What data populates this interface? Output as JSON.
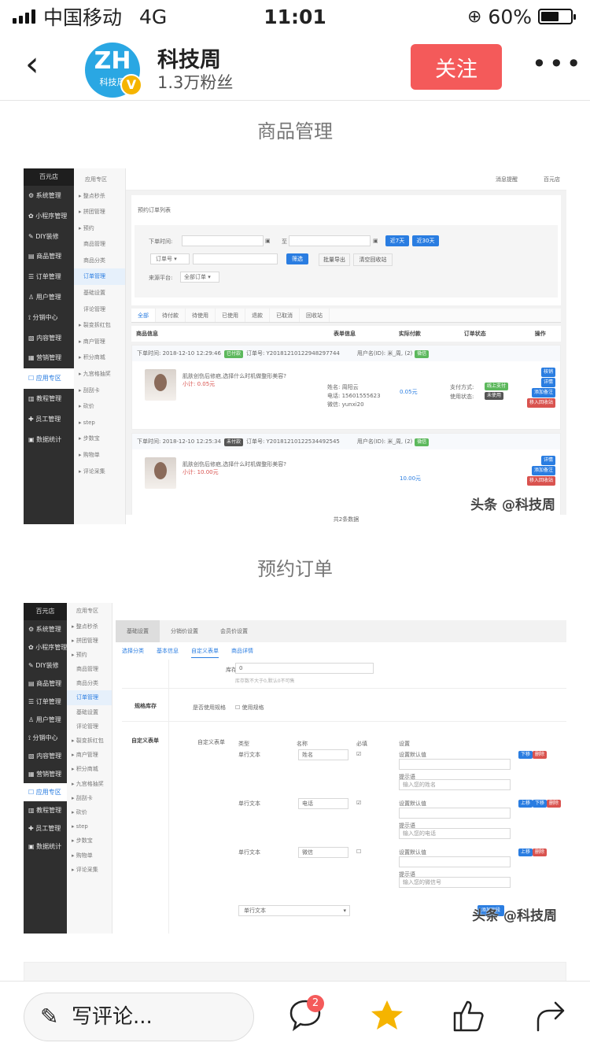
{
  "status": {
    "carrier": "中国移动",
    "network": "4G",
    "time": "11:01",
    "battery_pct": "60%",
    "battery_level": 0.6
  },
  "header": {
    "author": "科技周",
    "avatar_text": "ZH",
    "avatar_sub": "科技周",
    "verified": "V",
    "fans": "1.3万粉丝",
    "follow": "关注"
  },
  "captions": {
    "first": "商品管理",
    "second": "预约订单"
  },
  "watermark": "头条 @科技周",
  "admin": {
    "brand": "百元店",
    "sidebar": [
      "系统管理",
      "小程序管理",
      "DIY装修",
      "商品管理",
      "订单管理",
      "用户管理",
      "分销中心",
      "内容管理",
      "营销管理",
      "应用专区",
      "教程管理",
      "员工管理",
      "数据统计"
    ],
    "sidebar_active": 9,
    "sub_title": "应用专区",
    "sub_items": [
      "整点秒杀",
      "拼团管理",
      "预约",
      "商品管理",
      "商品分类",
      "订单管理",
      "基础设置",
      "评论管理",
      "裂变拆红包",
      "商户管理",
      "积分商城",
      "九宫格抽奖",
      "刮刮卡",
      "砍价",
      "step",
      "步数宝",
      "购物单",
      "评论采集"
    ]
  },
  "shot1": {
    "topbar": {
      "msg": "消息提醒",
      "store": "百元店"
    },
    "panel_title": "预约订单列表",
    "filter": {
      "time_label": "下单时间:",
      "to": "至",
      "btn_7": "近7天",
      "btn_30": "近30天",
      "order_no": "订单号",
      "search": "筛选",
      "export": "批量导出",
      "clear": "清空回收站",
      "source_label": "来源平台:",
      "source_value": "全部订单"
    },
    "tabs": [
      "全部",
      "待付款",
      "待使用",
      "已使用",
      "退款",
      "已取消",
      "回收站"
    ],
    "columns": [
      "商品信息",
      "表单信息",
      "实际付款",
      "订单状态",
      "操作"
    ],
    "orders": [
      {
        "time": "下单时间: 2018-12-10 12:29:46",
        "tag": "已付款",
        "tag_color": "#5cb85c",
        "order_no": "订单号: Y20181210122948297744",
        "user": "用户名(ID): 米_周, (2)",
        "user_tag": "微信",
        "title": "肌肤创伤后修疤,选择什么时机做整形美容?",
        "subtotal": "小计: 0.05元",
        "form": [
          "姓名: 周阳云",
          "电话: 15601555623",
          "微信: yunxi20"
        ],
        "paid": "0.05元",
        "status": [
          "支付方式:",
          "线上支付",
          "使用状态:",
          "未使用"
        ],
        "ops": [
          "核销",
          "详情",
          "添加备注",
          "移入回收站"
        ]
      },
      {
        "time": "下单时间: 2018-12-10 12:25:34",
        "tag": "未付款",
        "tag_color": "#555555",
        "order_no": "订单号: Y20181210122534492545",
        "user": "用户名(ID): 米_周, (2)",
        "user_tag": "微信",
        "title": "肌肤创伤后修疤,选择什么时机做整形美容?",
        "subtotal": "小计: 10.00元",
        "form": [],
        "paid": "10.00元",
        "status": [],
        "ops": [
          "详情",
          "添加备注",
          "移入回收站"
        ]
      }
    ],
    "footer": "共2条数据"
  },
  "shot2": {
    "top_tabs": [
      "基础设置",
      "分销价设置",
      "会员价设置"
    ],
    "sub_tabs": [
      "选择分类",
      "基本信息",
      "自定义表单",
      "商品详情"
    ],
    "stock_label": "库存",
    "stock_value": "0",
    "stock_hint": "库存数不大于0,默认0不可售",
    "spec_section": "规格库存",
    "spec_label": "是否使用规格",
    "spec_opt": "使用规格",
    "form_section": "自定义表单",
    "form_label": "自定义表单",
    "cols": [
      "类型",
      "名称",
      "必填",
      "设置"
    ],
    "rows": [
      {
        "type": "单行文本",
        "name": "姓名",
        "req": "✔",
        "default_label": "设置默认值",
        "hint_label": "提示语",
        "hint": "输入您的姓名",
        "btns": [
          "下移",
          "删除"
        ]
      },
      {
        "type": "单行文本",
        "name": "电话",
        "req": "✔",
        "default_label": "设置默认值",
        "hint_label": "提示语",
        "hint": "输入您的电话",
        "btns": [
          "上移",
          "下移",
          "删除"
        ]
      },
      {
        "type": "单行文本",
        "name": "微信",
        "req": "",
        "default_label": "设置默认值",
        "hint_label": "提示语",
        "hint": "输入您的微信号",
        "btns": [
          "上移",
          "删除"
        ]
      }
    ],
    "select_value": "单行文本",
    "add_btn": "添加字段"
  },
  "bottom": {
    "comment": "写评论...",
    "comment_count": "2"
  }
}
